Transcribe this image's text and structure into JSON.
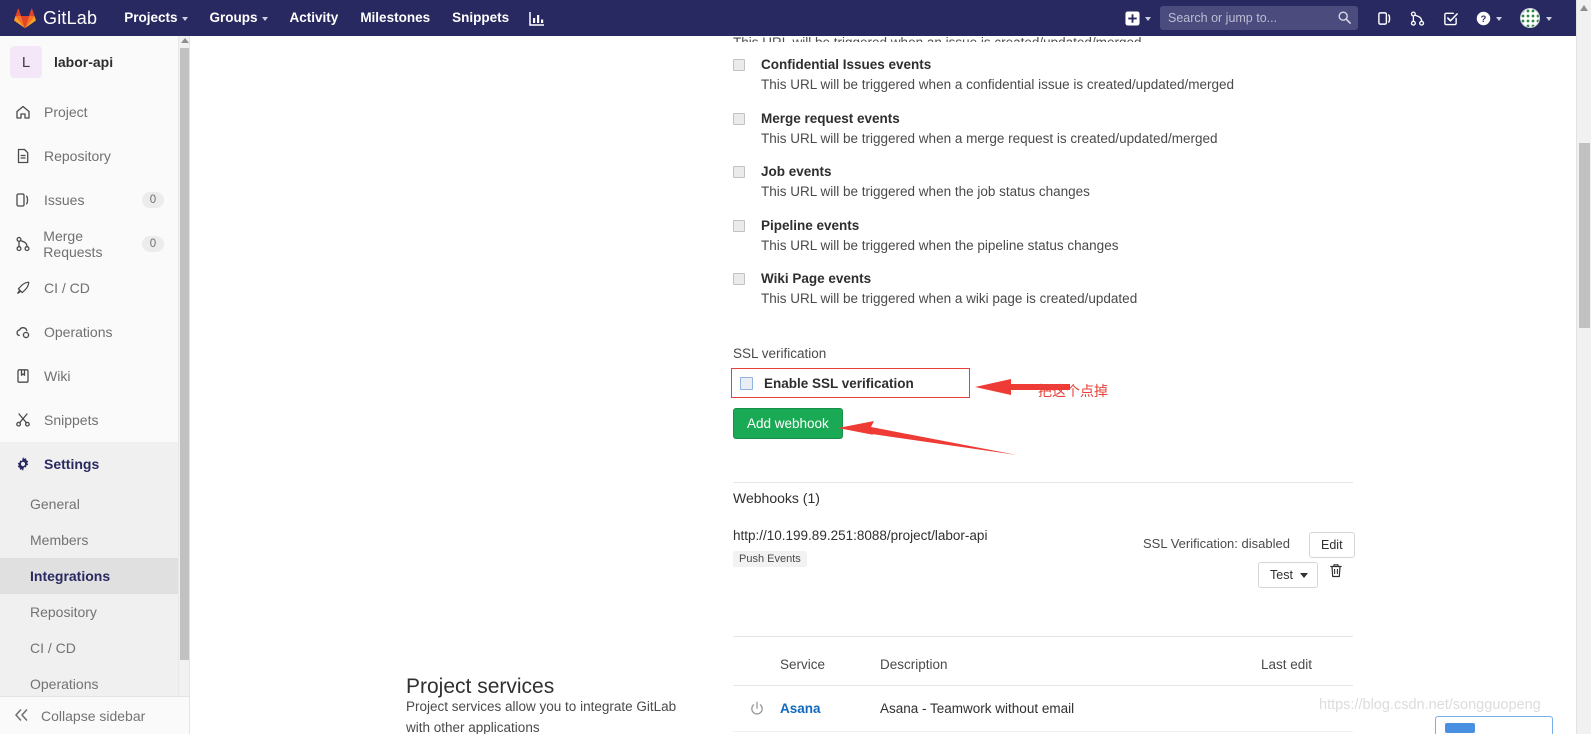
{
  "navbar": {
    "brand": "GitLab",
    "brand_icon": "gitlab-tanuki-logo",
    "links": [
      {
        "label": "Projects",
        "caret": true
      },
      {
        "label": "Groups",
        "caret": true
      },
      {
        "label": "Activity",
        "caret": false
      },
      {
        "label": "Milestones",
        "caret": false
      },
      {
        "label": "Snippets",
        "caret": false
      }
    ],
    "chart_icon": "analytics-chart-icon",
    "plus_icon": "plus-square-icon",
    "search": {
      "placeholder": "Search or jump to...",
      "value": ""
    },
    "right_icons": [
      "issues-icon",
      "merge-requests-icon",
      "todos-checkbox-icon",
      "help-question-icon"
    ],
    "avatar": "user-avatar"
  },
  "sidebar": {
    "project": {
      "initial": "L",
      "name": "labor-api"
    },
    "items": [
      {
        "label": "Project",
        "icon": "home-icon",
        "badge": ""
      },
      {
        "label": "Repository",
        "icon": "doc-icon",
        "badge": ""
      },
      {
        "label": "Issues",
        "icon": "issues-icon",
        "badge": "0"
      },
      {
        "label": "Merge Requests",
        "icon": "merge-icon",
        "badge": "0"
      },
      {
        "label": "CI / CD",
        "icon": "rocket-icon",
        "badge": ""
      },
      {
        "label": "Operations",
        "icon": "cloud-gear-icon",
        "badge": ""
      },
      {
        "label": "Wiki",
        "icon": "book-icon",
        "badge": ""
      },
      {
        "label": "Snippets",
        "icon": "scissors-icon",
        "badge": ""
      }
    ],
    "settings": {
      "label": "Settings",
      "icon": "gear-icon"
    },
    "sub_items": [
      {
        "label": "General",
        "active": false
      },
      {
        "label": "Members",
        "active": false
      },
      {
        "label": "Integrations",
        "active": true
      },
      {
        "label": "Repository",
        "active": false
      },
      {
        "label": "CI / CD",
        "active": false
      },
      {
        "label": "Operations",
        "active": false
      }
    ],
    "collapse": {
      "label": "Collapse sidebar",
      "icon": "double-chevron-left-icon"
    }
  },
  "main": {
    "cut_off_top_text": "This URL will be triggered when an issue is created/updated/merged",
    "events": [
      {
        "title": "Confidential Issues events",
        "desc": "This URL will be triggered when a confidential issue is created/updated/merged",
        "checked": false
      },
      {
        "title": "Merge request events",
        "desc": "This URL will be triggered when a merge request is created/updated/merged",
        "checked": false
      },
      {
        "title": "Job events",
        "desc": "This URL will be triggered when the job status changes",
        "checked": false
      },
      {
        "title": "Pipeline events",
        "desc": "This URL will be triggered when the pipeline status changes",
        "checked": false
      },
      {
        "title": "Wiki Page events",
        "desc": "This URL will be triggered when a wiki page is created/updated",
        "checked": false
      }
    ],
    "ssl_section_label": "SSL verification",
    "ssl_checkbox_label": "Enable SSL verification",
    "ssl_checked": false,
    "add_webhook_label": "Add webhook",
    "webhooks_title": "Webhooks (1)",
    "webhook": {
      "url": "http://10.199.89.251:8088/project/labor-api",
      "tag": "Push Events",
      "ssl_status": "SSL Verification: disabled",
      "edit_label": "Edit",
      "test_label": "Test",
      "delete_icon": "trash-icon"
    },
    "project_services": {
      "heading": "Project services",
      "description": "Project services allow you to integrate GitLab with other applications",
      "columns": [
        "Service",
        "Description",
        "Last edit"
      ],
      "rows": [
        {
          "icon": "power-icon",
          "service": "Asana",
          "description": "Asana - Teamwork without email",
          "last_edit": ""
        }
      ]
    }
  },
  "annotations": {
    "note_text": "把这个点掉",
    "arrow_color": "#ef3b36",
    "box_color": "#e8403a"
  },
  "watermark": "https://blog.csdn.net/songguopeng",
  "colors": {
    "navbar_bg": "#292961",
    "accent_green": "#1aaa55",
    "link_blue": "#1068bf",
    "active_purple": "#292961"
  }
}
